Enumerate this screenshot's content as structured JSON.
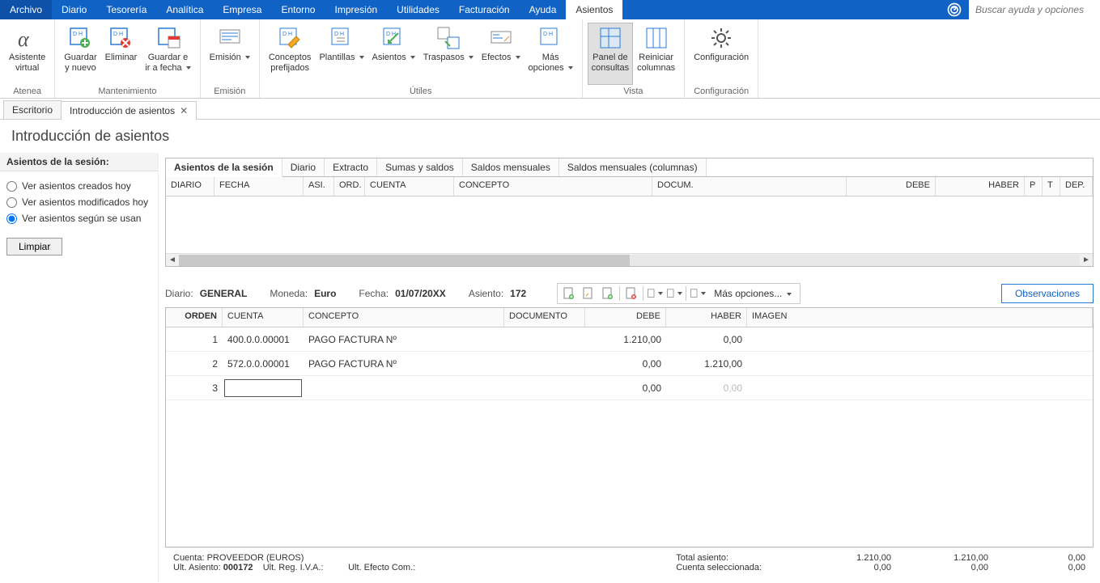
{
  "menubar": {
    "items": [
      "Archivo",
      "Diario",
      "Tesorería",
      "Analítica",
      "Empresa",
      "Entorno",
      "Impresión",
      "Utilidades",
      "Facturación",
      "Ayuda",
      "Asientos"
    ],
    "active_index": 10,
    "search_placeholder": "Buscar ayuda y opciones"
  },
  "ribbon": {
    "groups": [
      {
        "label": "Atenea",
        "items": [
          {
            "name": "asistente-virtual",
            "label": "Asistente\nvirtual"
          }
        ]
      },
      {
        "label": "Mantenimiento",
        "items": [
          {
            "name": "guardar-nuevo",
            "label": "Guardar\ny nuevo"
          },
          {
            "name": "eliminar",
            "label": "Eliminar"
          },
          {
            "name": "guardar-ir",
            "label": "Guardar e\nir a fecha",
            "arrow": true
          }
        ]
      },
      {
        "label": "Emisión",
        "items": [
          {
            "name": "emision",
            "label": "Emisión",
            "arrow": true
          }
        ]
      },
      {
        "label": "Útiles",
        "items": [
          {
            "name": "conceptos-prefijados",
            "label": "Conceptos\nprefijados"
          },
          {
            "name": "plantillas",
            "label": "Plantillas",
            "arrow": true
          },
          {
            "name": "asientos",
            "label": "Asientos",
            "arrow": true
          },
          {
            "name": "traspasos",
            "label": "Traspasos",
            "arrow": true
          },
          {
            "name": "efectos",
            "label": "Efectos",
            "arrow": true
          },
          {
            "name": "mas-opciones",
            "label": "Más\nopciones",
            "arrow": true
          }
        ]
      },
      {
        "label": "Vista",
        "items": [
          {
            "name": "panel-consultas",
            "label": "Panel de\nconsultas",
            "active": true
          },
          {
            "name": "reiniciar-columnas",
            "label": "Reiniciar\ncolumnas"
          }
        ]
      },
      {
        "label": "Configuración",
        "items": [
          {
            "name": "configuracion",
            "label": "Configuración"
          }
        ]
      }
    ]
  },
  "doc_tabs": [
    {
      "label": "Escritorio",
      "closable": false,
      "active": false
    },
    {
      "label": "Introducción de asientos",
      "closable": true,
      "active": true
    }
  ],
  "page_title": "Introducción de asientos",
  "sidebar": {
    "title": "Asientos de la sesión:",
    "radios": [
      {
        "label": "Ver asientos creados hoy",
        "checked": false
      },
      {
        "label": "Ver asientos modificados hoy",
        "checked": false
      },
      {
        "label": "Ver asientos según se usan",
        "checked": true
      }
    ],
    "limpiar": "Limpiar"
  },
  "consult": {
    "tabs": [
      "Asientos de la sesión",
      "Diario",
      "Extracto",
      "Sumas y saldos",
      "Saldos mensuales",
      "Saldos mensuales (columnas)"
    ],
    "active_tab": 0,
    "columns": [
      "DIARIO",
      "FECHA",
      "ASI.",
      "ORD.",
      "CUENTA",
      "CONCEPTO",
      "DOCUM.",
      "DEBE",
      "HABER",
      "P",
      "T",
      "DEP."
    ]
  },
  "entry_meta": {
    "diario_lbl": "Diario:",
    "diario_val": "GENERAL",
    "moneda_lbl": "Moneda:",
    "moneda_val": "Euro",
    "fecha_lbl": "Fecha:",
    "fecha_val": "01/07/20XX",
    "asiento_lbl": "Asiento:",
    "asiento_val": "172",
    "mas_opciones": "Más opciones...",
    "observaciones": "Observaciones"
  },
  "entry_columns": [
    "ORDEN",
    "CUENTA",
    "CONCEPTO",
    "DOCUMENTO",
    "DEBE",
    "HABER",
    "IMAGEN"
  ],
  "entry_rows": [
    {
      "orden": "1",
      "cuenta": "400.0.0.00001",
      "concepto": "PAGO FACTURA Nº",
      "documento": "",
      "debe": "1.210,00",
      "haber": "0,00"
    },
    {
      "orden": "2",
      "cuenta": "572.0.0.00001",
      "concepto": "PAGO FACTURA Nº",
      "documento": "",
      "debe": "0,00",
      "haber": "1.210,00"
    },
    {
      "orden": "3",
      "cuenta": "",
      "concepto": "",
      "documento": "",
      "debe": "0,00",
      "haber": "0,00",
      "editing": true
    }
  ],
  "footer": {
    "cuenta_lbl": "Cuenta:",
    "cuenta_val": "PROVEEDOR (EUROS)",
    "ult_asiento_lbl": "Ult. Asiento:",
    "ult_asiento_val": "000172",
    "ult_reg_iva": "Ult. Reg. I.V.A.:",
    "ult_efecto": "Ult. Efecto Com.:",
    "total_asiento_lbl": "Total asiento:",
    "cuenta_sel_lbl": "Cuenta seleccionada:",
    "totals_row1": [
      "1.210,00",
      "1.210,00",
      "0,00"
    ],
    "totals_row2": [
      "0,00",
      "0,00",
      "0,00"
    ]
  }
}
